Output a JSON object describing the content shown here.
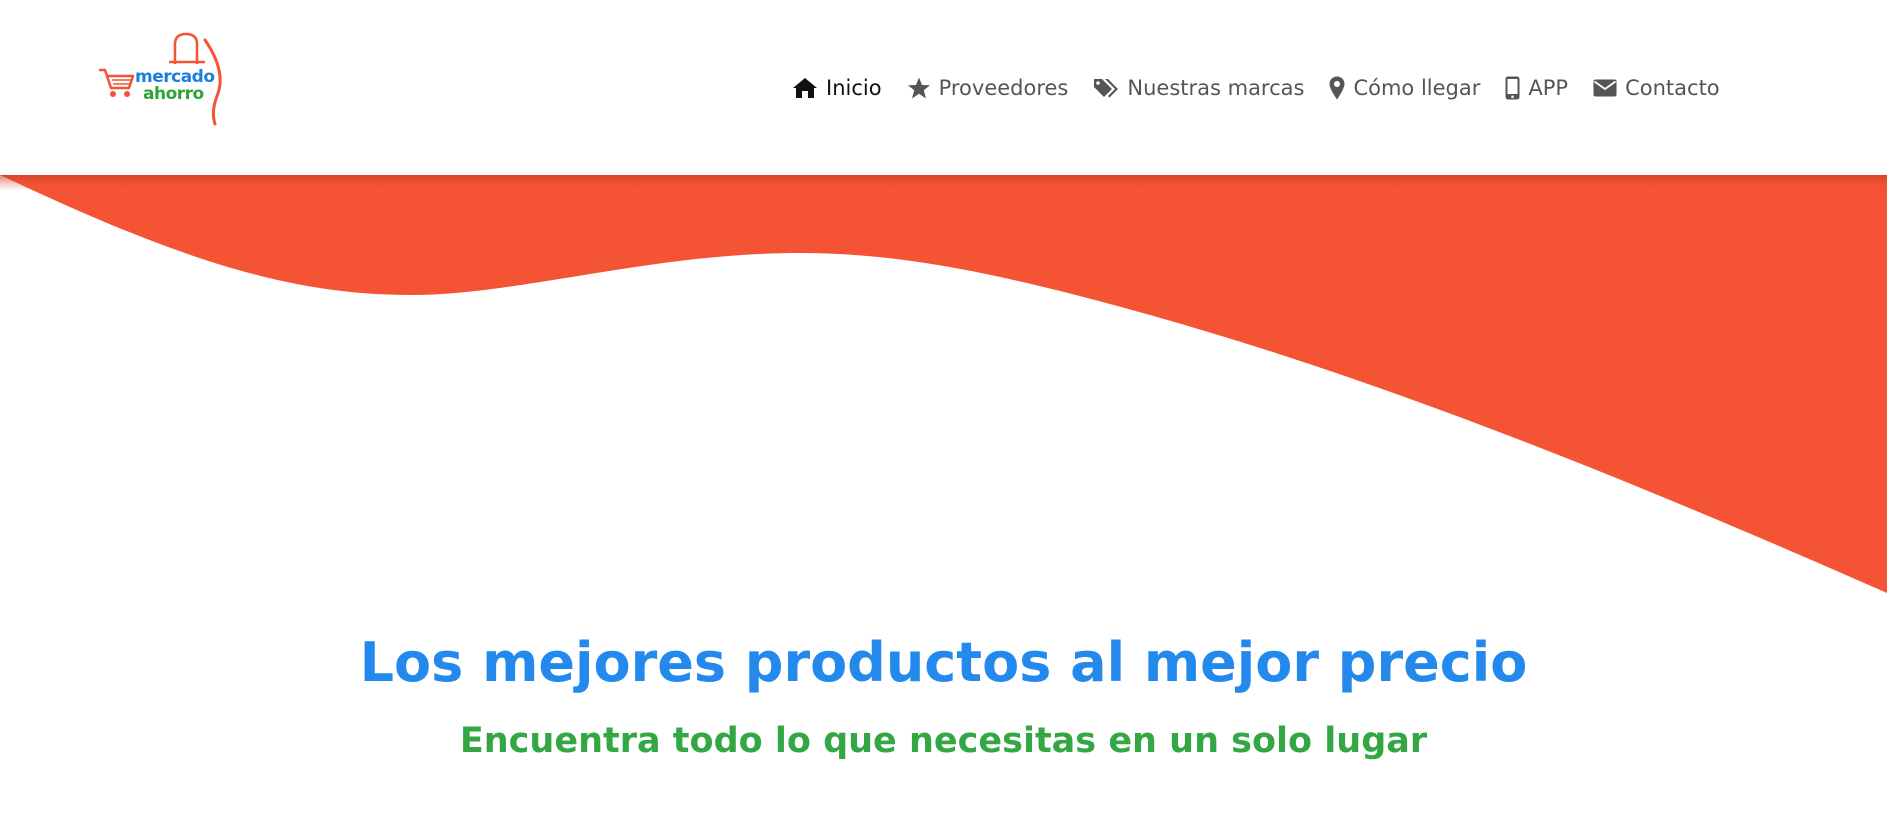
{
  "logo": {
    "word_top": "mercado",
    "word_bottom": "ahorro",
    "icon": "shopping-cart-icon",
    "colors": {
      "word_top": "#1b7fe0",
      "word_bottom": "#2ba43a",
      "accent": "#f45434"
    }
  },
  "nav": {
    "items": [
      {
        "label": "Inicio",
        "icon": "home-icon",
        "active": true
      },
      {
        "label": "Proveedores",
        "icon": "star-icon",
        "active": false
      },
      {
        "label": "Nuestras marcas",
        "icon": "tags-icon",
        "active": false
      },
      {
        "label": "Cómo llegar",
        "icon": "map-marker-icon",
        "active": false
      },
      {
        "label": "APP",
        "icon": "mobile-icon",
        "active": false
      },
      {
        "label": "Contacto",
        "icon": "envelope-icon",
        "active": false
      }
    ]
  },
  "hero": {
    "headline": "Los mejores productos al mejor precio",
    "subhead": "Encuentra todo lo que necesitas en un solo lugar",
    "colors": {
      "wave": "#f45434",
      "headline": "#2489ec",
      "subhead": "#34a745"
    }
  }
}
